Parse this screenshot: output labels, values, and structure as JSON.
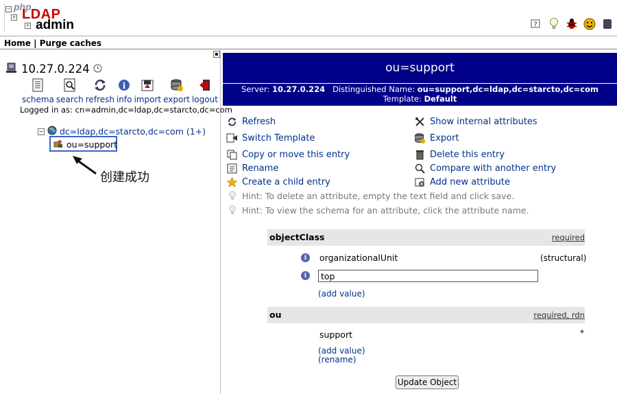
{
  "logo": {
    "php": "php",
    "ldap": "LDAP",
    "admin": "admin"
  },
  "menu": {
    "home": "Home",
    "sep": "|",
    "purge": "Purge caches"
  },
  "server": {
    "host": "10.27.0.224",
    "tools": [
      "schema",
      "search",
      "refresh",
      "info",
      "import",
      "export",
      "logout"
    ],
    "logged_in": "Logged in as: cn=admin,dc=ldap,dc=starcto,dc=com"
  },
  "tree": {
    "root": "dc=ldap,dc=starcto,dc=com (1+)",
    "child": "ou=support",
    "expand_symbol": "−"
  },
  "annotation": {
    "text": "创建成功"
  },
  "entry": {
    "title": "ou=support",
    "server_label": "Server:",
    "server_value": "10.27.0.224",
    "dn_label": "Distinguished Name:",
    "dn_value": "ou=support,dc=ldap,dc=starcto,dc=com",
    "template_label": "Template:",
    "template_value": "Default"
  },
  "actions": {
    "refresh": "Refresh",
    "show_internal": "Show internal attributes",
    "switch_template": "Switch Template",
    "export": "Export",
    "copy_move": "Copy or move this entry",
    "delete": "Delete this entry",
    "rename": "Rename",
    "compare": "Compare with another entry",
    "create_child": "Create a child entry",
    "add_attribute": "Add new attribute",
    "hint1": "Hint: To delete an attribute, empty the text field and click save.",
    "hint2": "Hint: To view the schema for an attribute, click the attribute name."
  },
  "attributes": {
    "objectclass": {
      "name": "objectClass",
      "req": "required",
      "value1": "organizationalUnit",
      "value1_type": "(structural)",
      "value2": "top",
      "add_value": "(add value)"
    },
    "ou": {
      "name": "ou",
      "req": "required, rdn",
      "value": "support",
      "star": "*",
      "add_value": "(add value)",
      "rename": "(rename)"
    }
  },
  "buttons": {
    "update": "Update Object"
  },
  "colors": {
    "title_bar": "#000088",
    "link": "#00308a",
    "annotation_box": "#3a65c8"
  }
}
